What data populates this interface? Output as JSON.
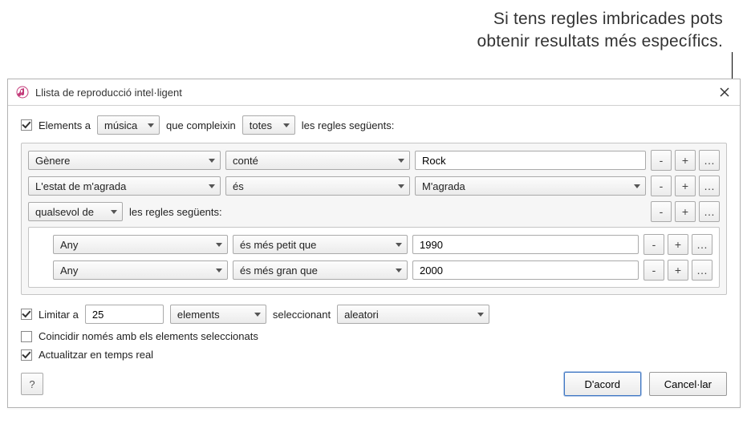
{
  "callout": {
    "line1": "Si tens regles imbricades pots",
    "line2": "obtenir resultats més específics."
  },
  "dialog": {
    "title": "Llista de reproducció intel·ligent"
  },
  "match": {
    "checkbox_label": "Elements a",
    "library_select": "música",
    "mid_text": "que compleixin",
    "quantifier_select": "totes",
    "trailing_text": "les regles següents:"
  },
  "rules": [
    {
      "field": "Gènere",
      "op": "conté",
      "value_type": "text",
      "value": "Rock"
    },
    {
      "field": "L'estat de m'agrada",
      "op": "és",
      "value_type": "select",
      "value": "M'agrada"
    }
  ],
  "nested": {
    "quantifier": "qualsevol de",
    "trailing": "les regles següents:",
    "rules": [
      {
        "field": "Any",
        "op": "és més petit que",
        "value": "1990"
      },
      {
        "field": "Any",
        "op": "és més gran que",
        "value": "2000"
      }
    ]
  },
  "limit": {
    "label": "Limitar a",
    "value": "25",
    "unit": "elements",
    "selecting_label": "seleccionant",
    "method": "aleatori"
  },
  "opt_only_checked": "Coincidir només amb els elements seleccionats",
  "opt_live_update": "Actualitzar en temps real",
  "buttons": {
    "help": "?",
    "ok": "D'acord",
    "cancel": "Cancel·lar",
    "minus": "-",
    "plus": "+",
    "more": "…"
  }
}
